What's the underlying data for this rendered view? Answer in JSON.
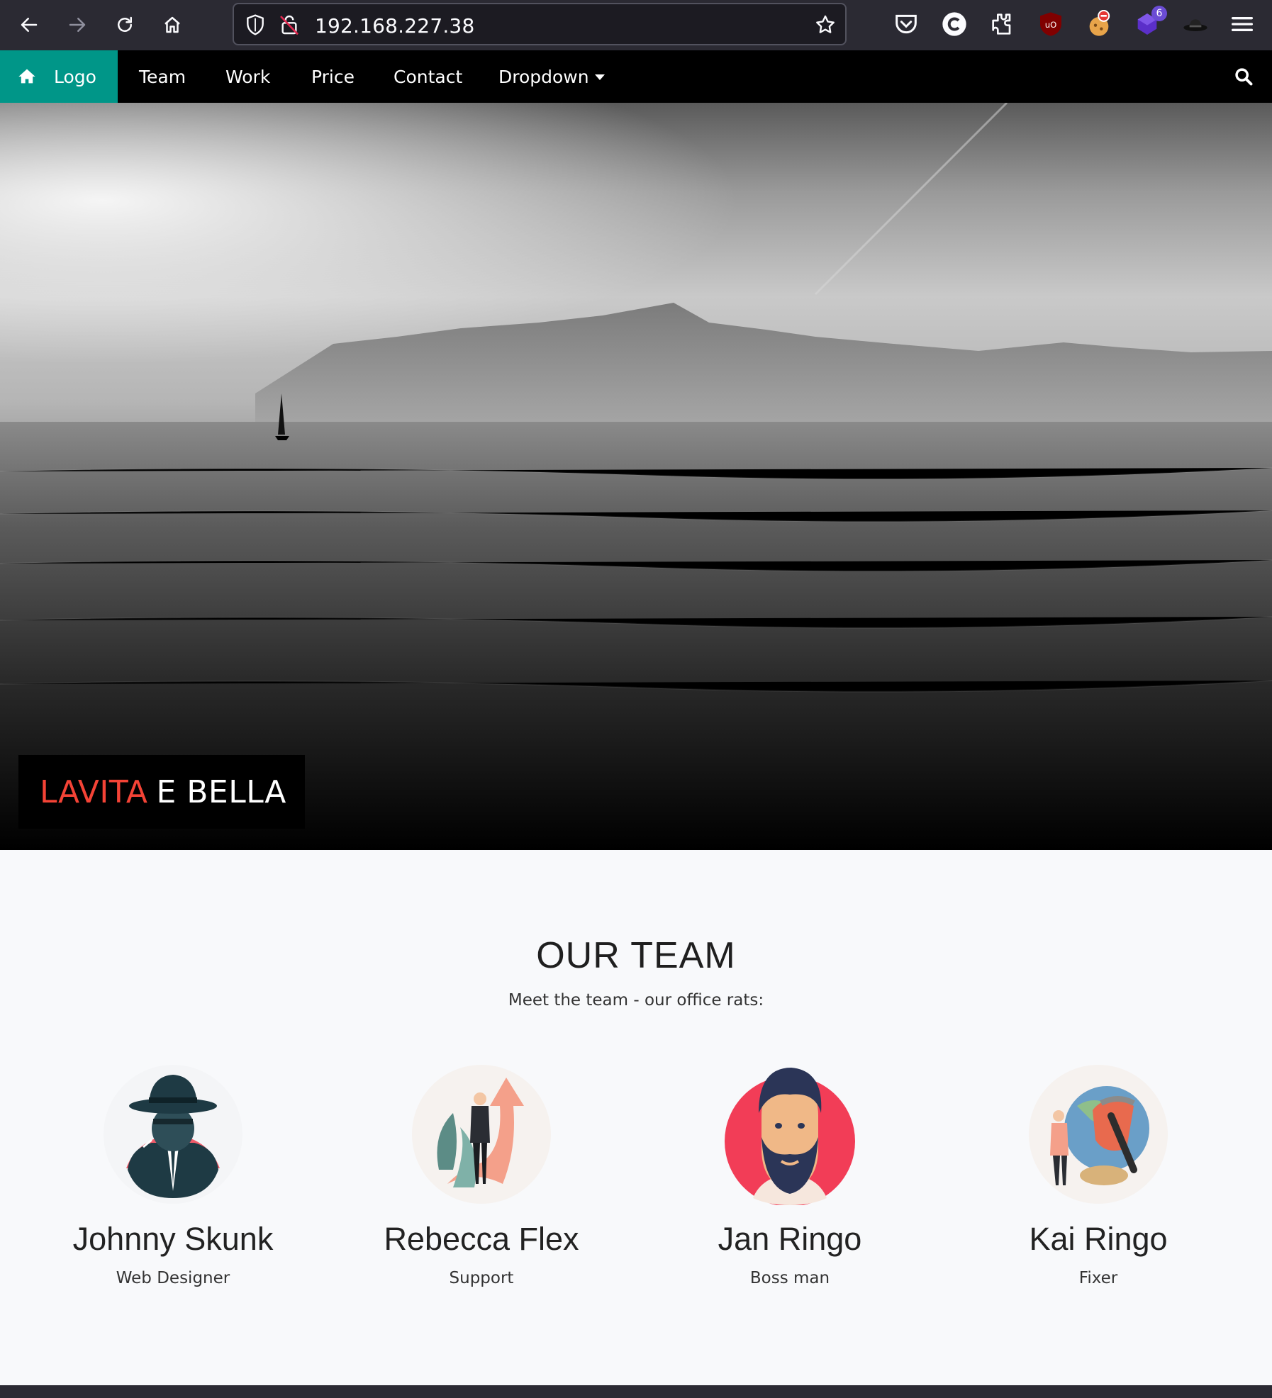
{
  "browser": {
    "url": "192.168.227.38",
    "extension_badge": "6",
    "colors": {
      "toolbar": "#2b2a33",
      "urlbar": "#1c1b22"
    }
  },
  "nav": {
    "logo_label": "Logo",
    "items": [
      {
        "label": "Team"
      },
      {
        "label": "Work"
      },
      {
        "label": "Price"
      },
      {
        "label": "Contact"
      },
      {
        "label": "Dropdown"
      }
    ],
    "colors": {
      "logo_bg": "#009688",
      "bar_bg": "#000000"
    }
  },
  "hero": {
    "caption_red": "LAVITA",
    "caption_white": "E BELLA",
    "colors": {
      "caption_red": "#f44336"
    }
  },
  "team": {
    "title": "OUR TEAM",
    "subtitle": "Meet the team - our office rats:",
    "members": [
      {
        "name": "Johnny Skunk",
        "role": "Web Designer",
        "icon": "spy-avatar-icon"
      },
      {
        "name": "Rebecca Flex",
        "role": "Support",
        "icon": "businessman-growth-avatar-icon"
      },
      {
        "name": "Jan Ringo",
        "role": "Boss man",
        "icon": "bearded-man-avatar-icon"
      },
      {
        "name": "Kai Ringo",
        "role": "Fixer",
        "icon": "miner-globe-avatar-icon"
      }
    ]
  }
}
